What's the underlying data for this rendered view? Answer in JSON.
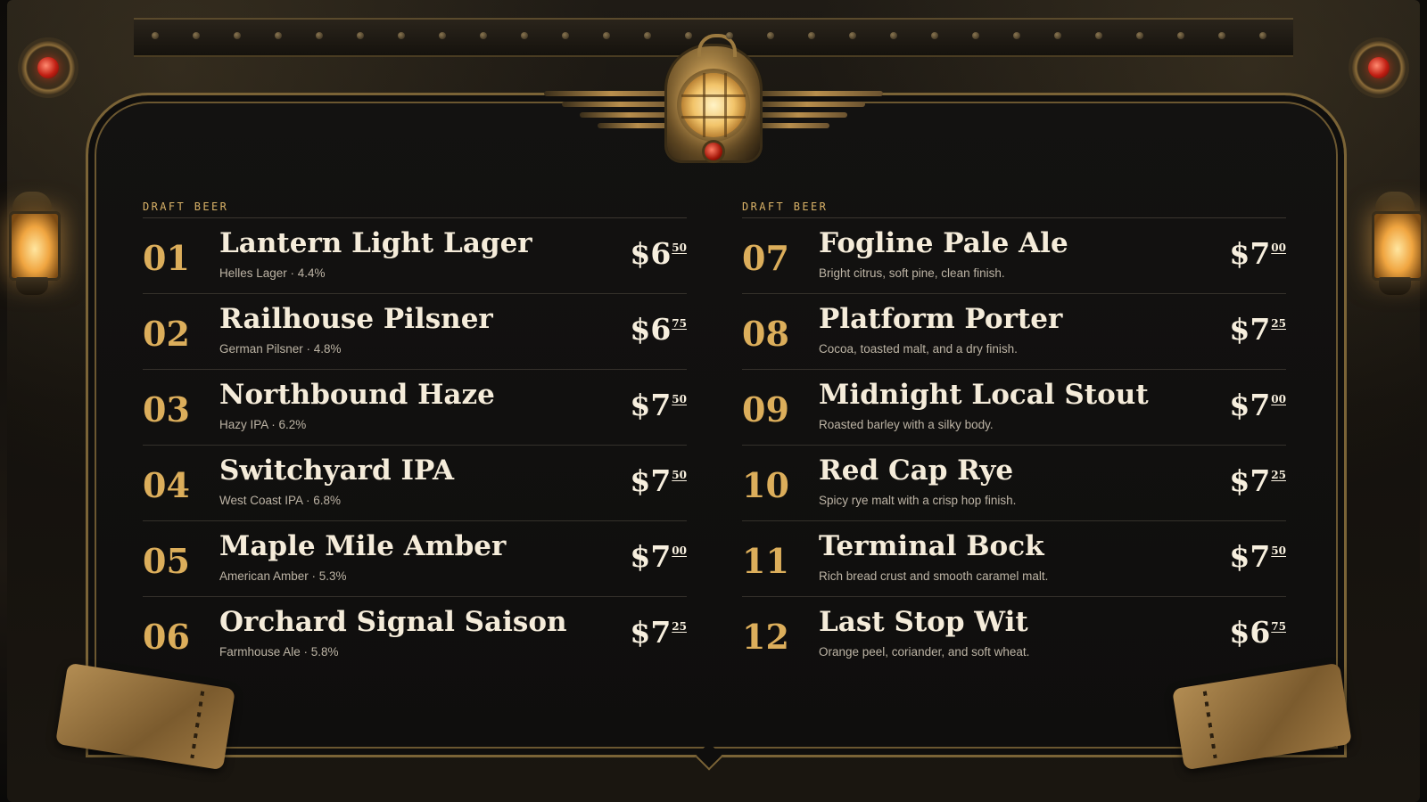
{
  "menu": {
    "left": {
      "section_label": "DRAFT BEER",
      "items": [
        {
          "number": "01",
          "name": "Lantern Light Lager",
          "desc": "Helles Lager · 4.4%",
          "price_dollars": "$6",
          "price_cents": "50"
        },
        {
          "number": "02",
          "name": "Railhouse Pilsner",
          "desc": "German Pilsner · 4.8%",
          "price_dollars": "$6",
          "price_cents": "75"
        },
        {
          "number": "03",
          "name": "Northbound Haze",
          "desc": "Hazy IPA · 6.2%",
          "price_dollars": "$7",
          "price_cents": "50"
        },
        {
          "number": "04",
          "name": "Switchyard IPA",
          "desc": "West Coast IPA · 6.8%",
          "price_dollars": "$7",
          "price_cents": "50"
        },
        {
          "number": "05",
          "name": "Maple Mile Amber",
          "desc": "American Amber · 5.3%",
          "price_dollars": "$7",
          "price_cents": "00"
        },
        {
          "number": "06",
          "name": "Orchard Signal Saison",
          "desc": "Farmhouse Ale · 5.8%",
          "price_dollars": "$7",
          "price_cents": "25"
        }
      ]
    },
    "right": {
      "section_label": "DRAFT BEER",
      "items": [
        {
          "number": "07",
          "name": "Fogline Pale Ale",
          "desc": "Bright citrus, soft pine, clean finish.",
          "price_dollars": "$7",
          "price_cents": "00"
        },
        {
          "number": "08",
          "name": "Platform Porter",
          "desc": "Cocoa, toasted malt, and a dry finish.",
          "price_dollars": "$7",
          "price_cents": "25"
        },
        {
          "number": "09",
          "name": "Midnight Local Stout",
          "desc": "Roasted barley with a silky body.",
          "price_dollars": "$7",
          "price_cents": "00"
        },
        {
          "number": "10",
          "name": "Red Cap Rye",
          "desc": "Spicy rye malt with a crisp hop finish.",
          "price_dollars": "$7",
          "price_cents": "25"
        },
        {
          "number": "11",
          "name": "Terminal Bock",
          "desc": "Rich bread crust and smooth caramel malt.",
          "price_dollars": "$7",
          "price_cents": "50"
        },
        {
          "number": "12",
          "name": "Last Stop Wit",
          "desc": "Orange peel, coriander, and soft wheat.",
          "price_dollars": "$6",
          "price_cents": "75"
        }
      ]
    }
  },
  "colors": {
    "accent_gold": "#dcae5b",
    "label_gold": "#d9b267",
    "board_bg": "#121110",
    "text_primary": "#f5ecda",
    "text_secondary": "#bdb4a5",
    "signal_red": "#c01e12"
  },
  "decor": {
    "emblem": "winged-lantern-emblem-icon",
    "corner_lamps": "red-signal-lamp-icon",
    "wall_lanterns": "wall-lantern-icon",
    "tickets": "train-ticket-icon"
  }
}
